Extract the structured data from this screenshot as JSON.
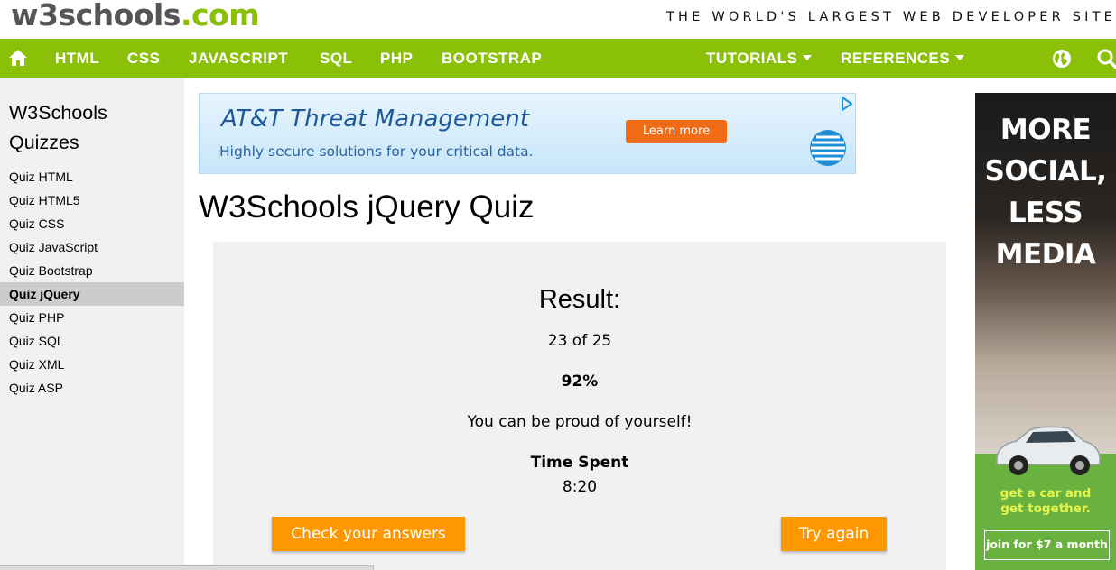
{
  "header": {
    "logo_main": "w3schools",
    "logo_tld": ".com",
    "tagline": "THE WORLD'S LARGEST WEB DEVELOPER SITE"
  },
  "nav": {
    "home_icon": "home-icon",
    "items": [
      "HTML",
      "CSS",
      "JAVASCRIPT",
      "SQL",
      "PHP",
      "BOOTSTRAP"
    ],
    "tutorials": "TUTORIALS",
    "references": "REFERENCES",
    "globe_icon": "globe-icon",
    "search_icon": "search-icon"
  },
  "sidebar": {
    "title": "W3Schools Quizzes",
    "items": [
      "Quiz HTML",
      "Quiz HTML5",
      "Quiz CSS",
      "Quiz JavaScript",
      "Quiz Bootstrap",
      "Quiz jQuery",
      "Quiz PHP",
      "Quiz SQL",
      "Quiz XML",
      "Quiz ASP"
    ],
    "active_index": 5
  },
  "ad_banner": {
    "headline": "AT&T Threat Management",
    "subline": "Highly secure solutions for your critical data.",
    "cta": "Learn more",
    "brand_color": "#f26b17"
  },
  "main": {
    "title": "W3Schools jQuery Quiz"
  },
  "result": {
    "heading": "Result:",
    "score": "23 of 25",
    "percent": "92%",
    "message": "You can be proud of yourself!",
    "time_label": "Time Spent",
    "time_value": "8:20",
    "check_button": "Check your answers",
    "try_button": "Try again"
  },
  "side_ad": {
    "headline_lines": [
      "MORE",
      "SOCIAL,",
      "LESS",
      "MEDIA"
    ],
    "tag_lines": [
      "get a car and",
      "get together."
    ],
    "button": "join for $7 a month"
  },
  "colors": {
    "brand_green": "#8ac007",
    "button_orange": "#ff9800",
    "panel_gray": "#f1f1f1"
  }
}
